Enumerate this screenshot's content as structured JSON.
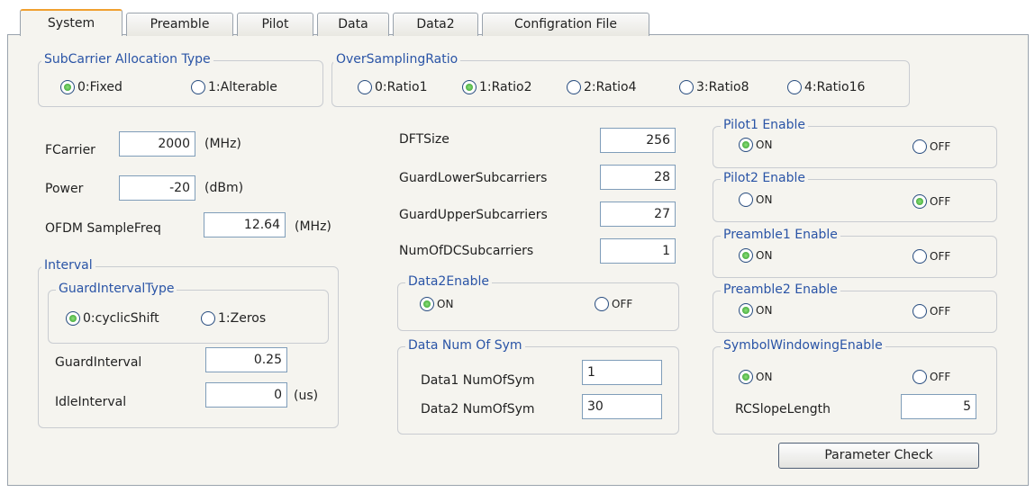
{
  "tabs": [
    {
      "label": "System",
      "active": true
    },
    {
      "label": "Preamble",
      "active": false
    },
    {
      "label": "Pilot",
      "active": false
    },
    {
      "label": "Data",
      "active": false
    },
    {
      "label": "Data2",
      "active": false
    },
    {
      "label": "Configration File",
      "active": false
    }
  ],
  "subcarrier_alloc": {
    "title": "SubCarrier Allocation Type",
    "options": [
      {
        "label": "0:Fixed",
        "selected": true
      },
      {
        "label": "1:Alterable",
        "selected": false
      }
    ]
  },
  "oversampling": {
    "title": "OverSamplingRatio",
    "options": [
      {
        "label": "0:Ratio1",
        "selected": false
      },
      {
        "label": "1:Ratio2",
        "selected": true
      },
      {
        "label": "2:Ratio4",
        "selected": false
      },
      {
        "label": "3:Ratio8",
        "selected": false
      },
      {
        "label": "4:Ratio16",
        "selected": false
      }
    ]
  },
  "fcarrier": {
    "label": "FCarrier",
    "value": "2000",
    "unit": "(MHz)"
  },
  "power": {
    "label": "Power",
    "value": "-20",
    "unit": "(dBm)"
  },
  "ofdm_samplefreq": {
    "label": "OFDM SampleFreq",
    "value": "12.64",
    "unit": "(MHz)"
  },
  "interval": {
    "title": "Interval",
    "guard_type": {
      "title": "GuardIntervalType",
      "options": [
        {
          "label": "0:cyclicShift",
          "selected": true
        },
        {
          "label": "1:Zeros",
          "selected": false
        }
      ]
    },
    "guard_interval": {
      "label": "GuardInterval",
      "value": "0.25"
    },
    "idle_interval": {
      "label": "IdleInterval",
      "value": "0",
      "unit": "(us)"
    }
  },
  "dft_size": {
    "label": "DFTSize",
    "value": "256"
  },
  "guard_lower": {
    "label": "GuardLowerSubcarriers",
    "value": "28"
  },
  "guard_upper": {
    "label": "GuardUpperSubcarriers",
    "value": "27"
  },
  "num_dc": {
    "label": "NumOfDCSubcarriers",
    "value": "1"
  },
  "data2_enable": {
    "title": "Data2Enable",
    "on_label": "ON",
    "off_label": "OFF",
    "on": true
  },
  "data_num_sym": {
    "title": "Data Num Of Sym",
    "data1": {
      "label": "Data1 NumOfSym",
      "value": "1"
    },
    "data2": {
      "label": "Data2 NumOfSym",
      "value": "30"
    }
  },
  "pilot1_enable": {
    "title": "Pilot1 Enable",
    "on_label": "ON",
    "off_label": "OFF",
    "on": true
  },
  "pilot2_enable": {
    "title": "Pilot2 Enable",
    "on_label": "ON",
    "off_label": "OFF",
    "on": false
  },
  "preamble1_enable": {
    "title": "Preamble1 Enable",
    "on_label": "ON",
    "off_label": "OFF",
    "on": true
  },
  "preamble2_enable": {
    "title": "Preamble2 Enable",
    "on_label": "ON",
    "off_label": "OFF",
    "on": true
  },
  "symbol_windowing": {
    "title": "SymbolWindowingEnable",
    "on_label": "ON",
    "off_label": "OFF",
    "on": true,
    "rcslope": {
      "label": "RCSlopeLength",
      "value": "5"
    }
  },
  "parameter_check_label": "Parameter Check"
}
